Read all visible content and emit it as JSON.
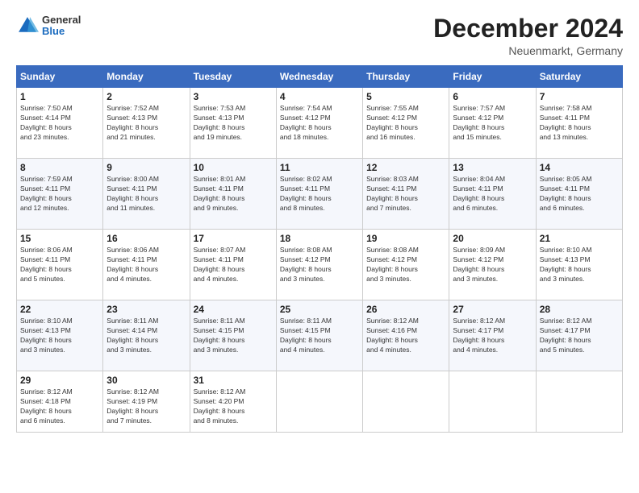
{
  "header": {
    "logo_line1": "General",
    "logo_line2": "Blue",
    "month_title": "December 2024",
    "location": "Neuenmarkt, Germany"
  },
  "days_of_week": [
    "Sunday",
    "Monday",
    "Tuesday",
    "Wednesday",
    "Thursday",
    "Friday",
    "Saturday"
  ],
  "weeks": [
    [
      {
        "day": "1",
        "info": "Sunrise: 7:50 AM\nSunset: 4:14 PM\nDaylight: 8 hours\nand 23 minutes."
      },
      {
        "day": "2",
        "info": "Sunrise: 7:52 AM\nSunset: 4:13 PM\nDaylight: 8 hours\nand 21 minutes."
      },
      {
        "day": "3",
        "info": "Sunrise: 7:53 AM\nSunset: 4:13 PM\nDaylight: 8 hours\nand 19 minutes."
      },
      {
        "day": "4",
        "info": "Sunrise: 7:54 AM\nSunset: 4:12 PM\nDaylight: 8 hours\nand 18 minutes."
      },
      {
        "day": "5",
        "info": "Sunrise: 7:55 AM\nSunset: 4:12 PM\nDaylight: 8 hours\nand 16 minutes."
      },
      {
        "day": "6",
        "info": "Sunrise: 7:57 AM\nSunset: 4:12 PM\nDaylight: 8 hours\nand 15 minutes."
      },
      {
        "day": "7",
        "info": "Sunrise: 7:58 AM\nSunset: 4:11 PM\nDaylight: 8 hours\nand 13 minutes."
      }
    ],
    [
      {
        "day": "8",
        "info": "Sunrise: 7:59 AM\nSunset: 4:11 PM\nDaylight: 8 hours\nand 12 minutes."
      },
      {
        "day": "9",
        "info": "Sunrise: 8:00 AM\nSunset: 4:11 PM\nDaylight: 8 hours\nand 11 minutes."
      },
      {
        "day": "10",
        "info": "Sunrise: 8:01 AM\nSunset: 4:11 PM\nDaylight: 8 hours\nand 9 minutes."
      },
      {
        "day": "11",
        "info": "Sunrise: 8:02 AM\nSunset: 4:11 PM\nDaylight: 8 hours\nand 8 minutes."
      },
      {
        "day": "12",
        "info": "Sunrise: 8:03 AM\nSunset: 4:11 PM\nDaylight: 8 hours\nand 7 minutes."
      },
      {
        "day": "13",
        "info": "Sunrise: 8:04 AM\nSunset: 4:11 PM\nDaylight: 8 hours\nand 6 minutes."
      },
      {
        "day": "14",
        "info": "Sunrise: 8:05 AM\nSunset: 4:11 PM\nDaylight: 8 hours\nand 6 minutes."
      }
    ],
    [
      {
        "day": "15",
        "info": "Sunrise: 8:06 AM\nSunset: 4:11 PM\nDaylight: 8 hours\nand 5 minutes."
      },
      {
        "day": "16",
        "info": "Sunrise: 8:06 AM\nSunset: 4:11 PM\nDaylight: 8 hours\nand 4 minutes."
      },
      {
        "day": "17",
        "info": "Sunrise: 8:07 AM\nSunset: 4:11 PM\nDaylight: 8 hours\nand 4 minutes."
      },
      {
        "day": "18",
        "info": "Sunrise: 8:08 AM\nSunset: 4:12 PM\nDaylight: 8 hours\nand 3 minutes."
      },
      {
        "day": "19",
        "info": "Sunrise: 8:08 AM\nSunset: 4:12 PM\nDaylight: 8 hours\nand 3 minutes."
      },
      {
        "day": "20",
        "info": "Sunrise: 8:09 AM\nSunset: 4:12 PM\nDaylight: 8 hours\nand 3 minutes."
      },
      {
        "day": "21",
        "info": "Sunrise: 8:10 AM\nSunset: 4:13 PM\nDaylight: 8 hours\nand 3 minutes."
      }
    ],
    [
      {
        "day": "22",
        "info": "Sunrise: 8:10 AM\nSunset: 4:13 PM\nDaylight: 8 hours\nand 3 minutes."
      },
      {
        "day": "23",
        "info": "Sunrise: 8:11 AM\nSunset: 4:14 PM\nDaylight: 8 hours\nand 3 minutes."
      },
      {
        "day": "24",
        "info": "Sunrise: 8:11 AM\nSunset: 4:15 PM\nDaylight: 8 hours\nand 3 minutes."
      },
      {
        "day": "25",
        "info": "Sunrise: 8:11 AM\nSunset: 4:15 PM\nDaylight: 8 hours\nand 4 minutes."
      },
      {
        "day": "26",
        "info": "Sunrise: 8:12 AM\nSunset: 4:16 PM\nDaylight: 8 hours\nand 4 minutes."
      },
      {
        "day": "27",
        "info": "Sunrise: 8:12 AM\nSunset: 4:17 PM\nDaylight: 8 hours\nand 4 minutes."
      },
      {
        "day": "28",
        "info": "Sunrise: 8:12 AM\nSunset: 4:17 PM\nDaylight: 8 hours\nand 5 minutes."
      }
    ],
    [
      {
        "day": "29",
        "info": "Sunrise: 8:12 AM\nSunset: 4:18 PM\nDaylight: 8 hours\nand 6 minutes."
      },
      {
        "day": "30",
        "info": "Sunrise: 8:12 AM\nSunset: 4:19 PM\nDaylight: 8 hours\nand 7 minutes."
      },
      {
        "day": "31",
        "info": "Sunrise: 8:12 AM\nSunset: 4:20 PM\nDaylight: 8 hours\nand 8 minutes."
      },
      null,
      null,
      null,
      null
    ]
  ]
}
